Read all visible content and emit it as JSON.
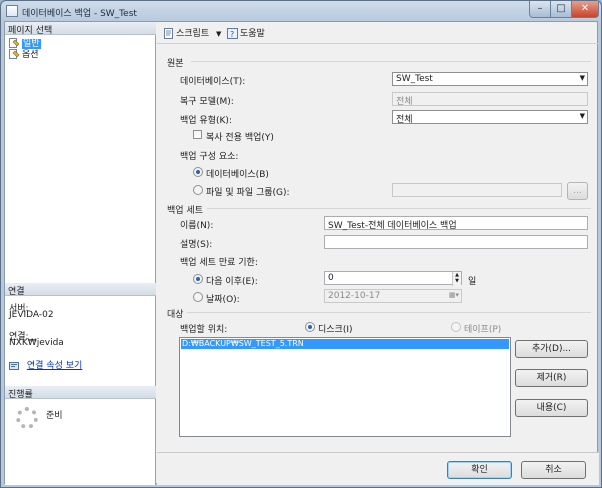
{
  "window": {
    "title": "데이터베이스 백업 - SW_Test"
  },
  "sidebar": {
    "select_page_header": "페이지 선택",
    "pages": [
      {
        "label": "일반",
        "selected": true,
        "icon": "page-icon"
      },
      {
        "label": "옵션",
        "selected": false,
        "icon": "page-icon"
      }
    ],
    "connection_header": "연결",
    "server_label": "서버:",
    "server_value": "JEVIDA-02",
    "connection_label": "연결:",
    "connection_value": "NXK₩jevida",
    "connection_link": "연결 속성 보기",
    "progress_header": "진행률",
    "progress_status": "준비"
  },
  "toolbar": {
    "script_label": "스크립트",
    "help_label": "도움말"
  },
  "source": {
    "section_label": "원본",
    "database_label": "데이터베이스(T):",
    "database_value": "SW_Test",
    "recovery_label": "복구 모델(M):",
    "recovery_value": "전체",
    "backup_type_label": "백업 유형(K):",
    "backup_type_value": "전체",
    "copy_only_label": "복사 전용 백업(Y)",
    "component_label": "백업 구성 요소:",
    "component_database": "데이터베이스(B)",
    "component_files": "파일 및 파일 그룹(G):",
    "browse_button": "..."
  },
  "backup_set": {
    "section_label": "백업 세트",
    "name_label": "이름(N):",
    "name_value": "SW_Test-전체 데이터베이스 백업",
    "desc_label": "설명(S):",
    "desc_value": "",
    "expire_label": "백업 세트 만료 기한:",
    "after_label": "다음 이후(E):",
    "after_value": "0",
    "days_label": "일",
    "on_label": "날짜(O):",
    "on_value": "2012-10-17"
  },
  "destination": {
    "section_label": "대상",
    "backup_to_label": "백업할 위치:",
    "disk_label": "디스크(I)",
    "tape_label": "테이프(P)",
    "files": [
      "D:₩BACKUP₩SW_TEST_5.TRN"
    ],
    "add_button": "추가(D)...",
    "remove_button": "제거(R)",
    "contents_button": "내용(C)"
  },
  "footer": {
    "ok_button": "확인",
    "cancel_button": "취소"
  }
}
